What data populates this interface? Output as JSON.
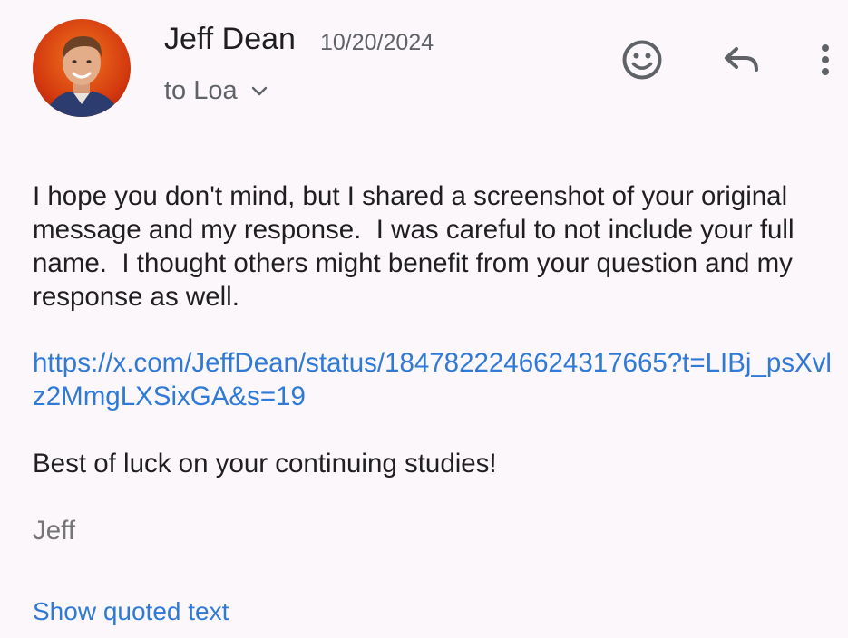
{
  "message": {
    "sender": {
      "name": "Jeff Dean",
      "date": "10/20/2024",
      "avatar_icon": "person-photo"
    },
    "recipient_line": "to Loa",
    "actions": {
      "emoji_icon": "smiley-face-icon",
      "reply_icon": "reply-arrow-icon",
      "more_icon": "more-vertical-icon"
    },
    "body": {
      "paragraph": "I hope you don't mind, but I shared a screenshot of your original message and my response.  I was careful to not include your full name.  I thought others might benefit from your question and my response as well.",
      "link": "https://x.com/JeffDean/status/1847822246624317665?t=LIBj_psXvlz2MmgLXSixGA&s=19",
      "closing": "Best of luck on your continuing studies!",
      "signature": "Jeff"
    },
    "show_quoted_label": "Show quoted text"
  },
  "colors": {
    "background": "#fcf7fb",
    "link": "#2f7ad6",
    "muted": "#5f6368",
    "text": "#1f1f1f"
  }
}
